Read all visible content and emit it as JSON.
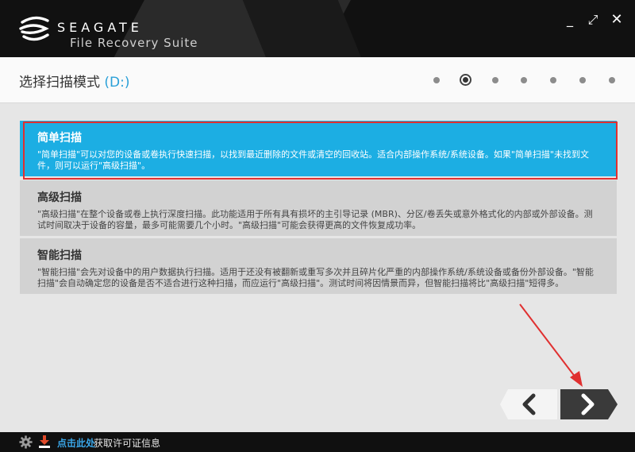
{
  "header": {
    "brand": "SEAGATE",
    "product": "File Recovery Suite",
    "minimize_label": "_",
    "maximize_label": "⤢",
    "close_label": "✕"
  },
  "step": {
    "title": "选择扫描模式",
    "drive": "(D:)",
    "total_steps": 7,
    "current_step": 2
  },
  "options": [
    {
      "title": "简单扫描",
      "description": "\"简单扫描\"可以对您的设备或卷执行快速扫描，以找到最近删除的文件或清空的回收站。适合内部操作系统/系统设备。如果\"简单扫描\"未找到文件，则可以运行\"高级扫描\"。",
      "selected": true
    },
    {
      "title": "高级扫描",
      "description": "\"高级扫描\"在整个设备或卷上执行深度扫描。此功能适用于所有具有损坏的主引导记录 (MBR)、分区/卷丢失或意外格式化的内部或外部设备。测试时间取决于设备的容量，最多可能需要几个小时。\"高级扫描\"可能会获得更高的文件恢复成功率。",
      "selected": false
    },
    {
      "title": "智能扫描",
      "description": "\"智能扫描\"会先对设备中的用户数据执行扫描。适用于还没有被翻新或重写多次并且碎片化严重的内部操作系统/系统设备或备份外部设备。\"智能扫描\"会自动确定您的设备是否不适合进行这种扫描，而应运行\"高级扫描\"。测试时间将因情景而异，但智能扫描将比\"高级扫描\"短得多。",
      "selected": false
    }
  ],
  "nav": {
    "back_icon": "chevron-left-icon",
    "next_icon": "chevron-right-icon"
  },
  "footer": {
    "link": "点击此处",
    "info": "获取许可证信息"
  },
  "colors": {
    "accent": "#1caee3",
    "annotation": "#e03030",
    "header_bg": "#111111"
  }
}
